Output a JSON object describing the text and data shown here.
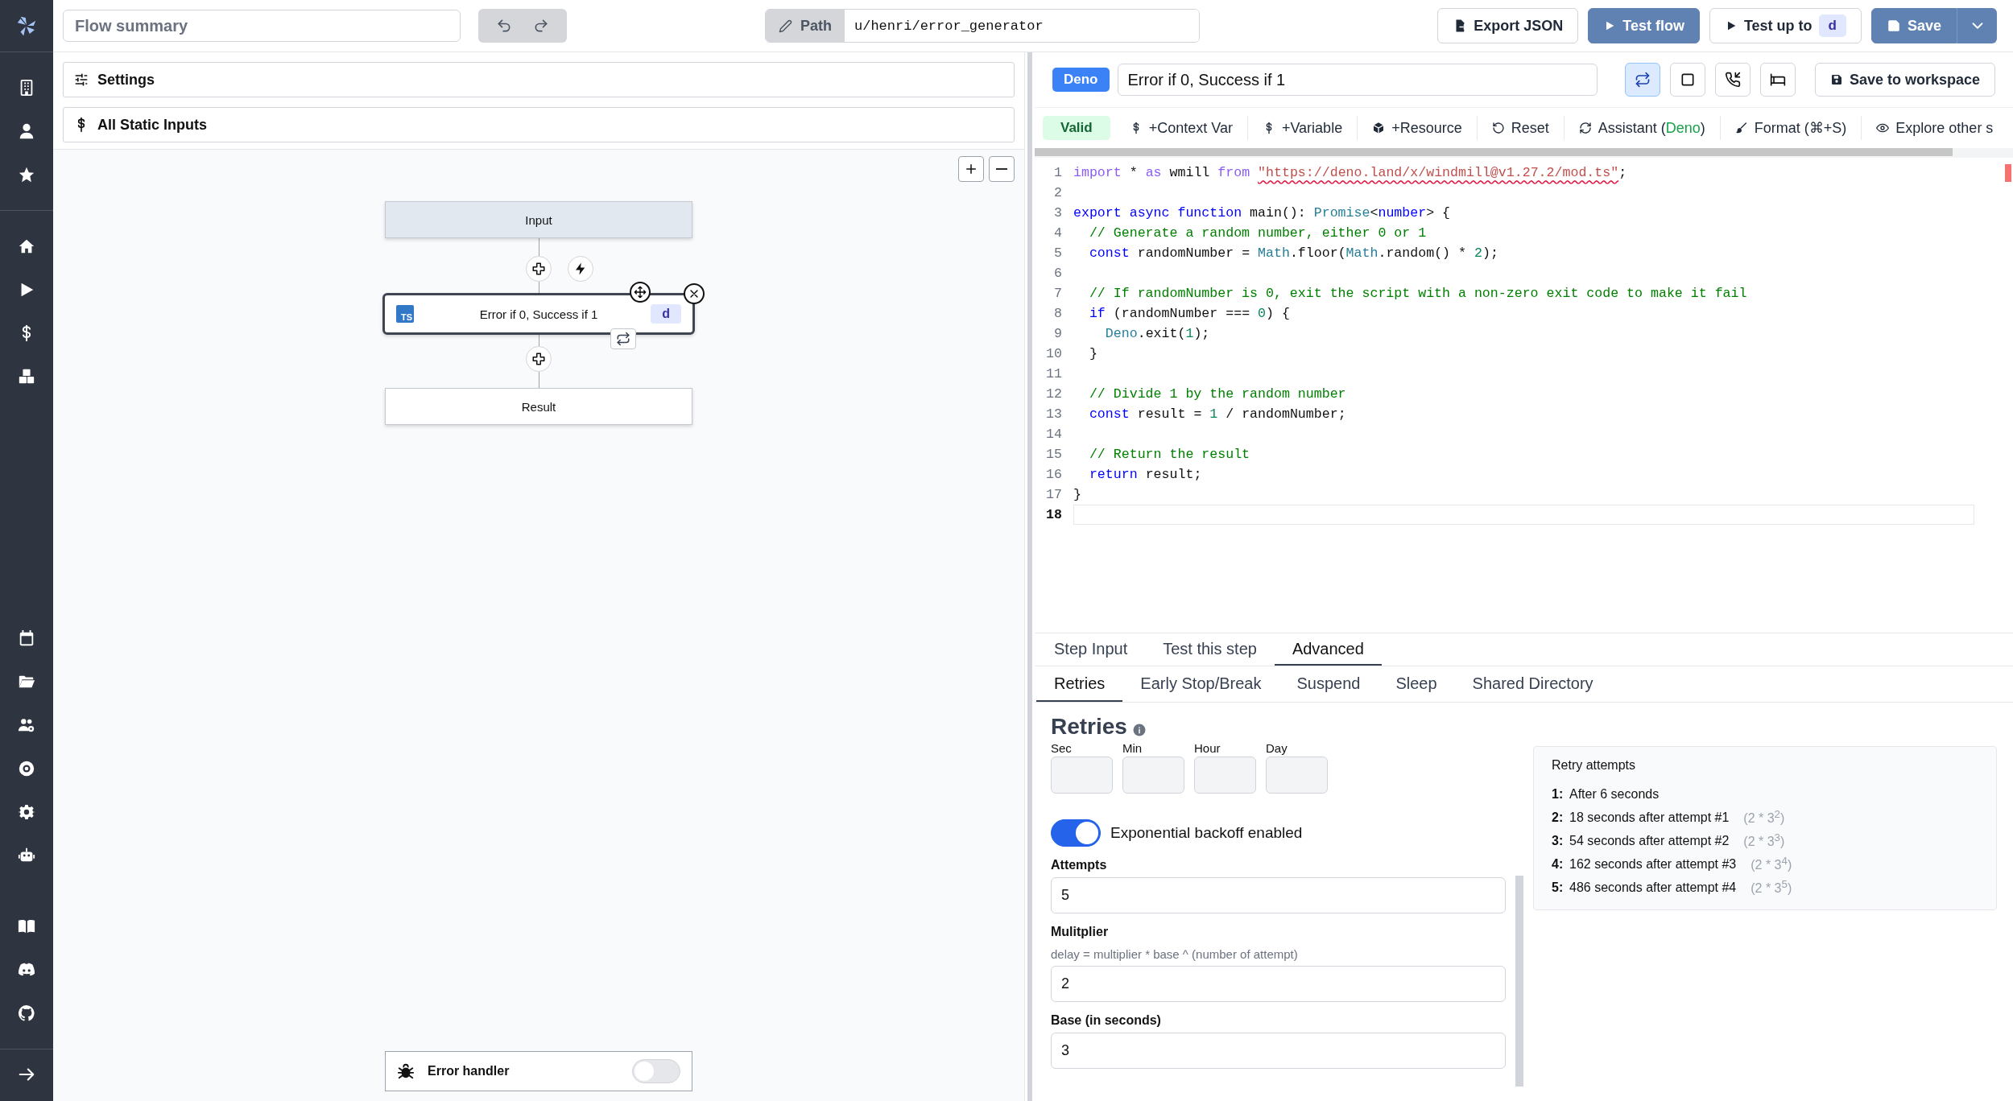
{
  "header": {
    "summary": {
      "placeholder": "Flow summary"
    },
    "path": {
      "label": "Path",
      "value": "u/henri/error_generator"
    },
    "actions": [
      {
        "kind": "export",
        "label": "Export JSON"
      },
      {
        "kind": "test",
        "label": "Test flow"
      },
      {
        "kind": "test_up_to",
        "label": "Test up to",
        "badge": "d"
      },
      {
        "kind": "save",
        "label": "Save"
      }
    ]
  },
  "left_panel": {
    "sections": [
      {
        "kind": "settings",
        "label": "Settings"
      },
      {
        "kind": "static_inputs",
        "label": "All Static Inputs"
      }
    ],
    "flow": {
      "nodes": [
        {
          "kind": "input",
          "label": "Input",
          "selected": false
        },
        {
          "kind": "step",
          "lang_icon": "TS",
          "label": "Error if 0, Success if 1",
          "badge": "d",
          "selected": true
        },
        {
          "kind": "result",
          "label": "Result",
          "selected": false
        }
      ]
    },
    "error_handler": {
      "label": "Error handler",
      "on": false
    }
  },
  "editor": {
    "language": "Deno",
    "title": "Error if 0, Success if 1",
    "icon_buttons": [
      {
        "kind": "loop",
        "selected": true
      },
      {
        "kind": "square",
        "selected": false
      },
      {
        "kind": "phone",
        "selected": false
      },
      {
        "kind": "bed",
        "selected": false
      }
    ],
    "save_button": "Save to workspace",
    "toolbar": [
      {
        "kind": "status",
        "label": "Valid"
      },
      {
        "kind": "dollar",
        "label": "+Context Var"
      },
      {
        "kind": "dollar",
        "label": "+Variable"
      },
      {
        "kind": "cube",
        "label": "+Resource"
      },
      {
        "kind": "reset",
        "label": "Reset"
      },
      {
        "kind": "assistant",
        "prefix": "Assistant (",
        "accent": "Deno",
        "suffix": ")"
      },
      {
        "kind": "brush",
        "label": "Format (⌘+S)"
      },
      {
        "kind": "eye",
        "label": "Explore other s"
      }
    ],
    "code": [
      {
        "number": "1",
        "current": false,
        "tokens": [
          {
            "kind": "control",
            "text": "import"
          },
          {
            "kind": "plain",
            "text": " * "
          },
          {
            "kind": "control",
            "text": "as"
          },
          {
            "kind": "plain",
            "text": " wmill "
          },
          {
            "kind": "control",
            "text": "from "
          },
          {
            "kind": "string_error",
            "text": "\"https://deno.land/x/windmill@v1.27.2/mod.ts\""
          },
          {
            "kind": "plain",
            "text": ";"
          }
        ]
      },
      {
        "number": "2",
        "current": false
      },
      {
        "number": "3",
        "current": false,
        "tokens": [
          {
            "kind": "keyword",
            "text": "export async function"
          },
          {
            "kind": "plain",
            "text": " main(): "
          },
          {
            "kind": "type",
            "text": "Promise"
          },
          {
            "kind": "plain",
            "text": "<"
          },
          {
            "kind": "keyword",
            "text": "number"
          },
          {
            "kind": "plain",
            "text": "> {"
          }
        ]
      },
      {
        "number": "4",
        "current": false,
        "tokens": [
          {
            "kind": "comment",
            "text": "  // Generate a random number, either 0 or 1"
          }
        ]
      },
      {
        "number": "5",
        "current": false,
        "tokens": [
          {
            "kind": "keyword",
            "text": "  const"
          },
          {
            "kind": "plain",
            "text": " randomNumber = "
          },
          {
            "kind": "type",
            "text": "Math"
          },
          {
            "kind": "plain",
            "text": ".floor("
          },
          {
            "kind": "type",
            "text": "Math"
          },
          {
            "kind": "plain",
            "text": ".random() * "
          },
          {
            "kind": "number",
            "text": "2"
          },
          {
            "kind": "plain",
            "text": ");"
          }
        ]
      },
      {
        "number": "6",
        "current": false
      },
      {
        "number": "7",
        "current": false,
        "tokens": [
          {
            "kind": "comment",
            "text": "  // If randomNumber is 0, exit the script with a non-zero exit code to make it fail"
          }
        ]
      },
      {
        "number": "8",
        "current": false,
        "tokens": [
          {
            "kind": "keyword",
            "text": "  if"
          },
          {
            "kind": "plain",
            "text": " (randomNumber === "
          },
          {
            "kind": "number",
            "text": "0"
          },
          {
            "kind": "plain",
            "text": ") {"
          }
        ]
      },
      {
        "number": "9",
        "current": false,
        "tokens": [
          {
            "kind": "type",
            "text": "    Deno"
          },
          {
            "kind": "plain",
            "text": ".exit("
          },
          {
            "kind": "number",
            "text": "1"
          },
          {
            "kind": "plain",
            "text": ");"
          }
        ]
      },
      {
        "number": "10",
        "current": false,
        "tokens": [
          {
            "kind": "plain",
            "text": "  }"
          }
        ]
      },
      {
        "number": "11",
        "current": false
      },
      {
        "number": "12",
        "current": false,
        "tokens": [
          {
            "kind": "comment",
            "text": "  // Divide 1 by the random number"
          }
        ]
      },
      {
        "number": "13",
        "current": false,
        "tokens": [
          {
            "kind": "keyword",
            "text": "  const"
          },
          {
            "kind": "plain",
            "text": " result = "
          },
          {
            "kind": "number",
            "text": "1"
          },
          {
            "kind": "plain",
            "text": " / randomNumber;"
          }
        ]
      },
      {
        "number": "14",
        "current": false
      },
      {
        "number": "15",
        "current": false,
        "tokens": [
          {
            "kind": "comment",
            "text": "  // Return the result"
          }
        ]
      },
      {
        "number": "16",
        "current": false,
        "tokens": [
          {
            "kind": "keyword",
            "text": "  return"
          },
          {
            "kind": "plain",
            "text": " result;"
          }
        ]
      },
      {
        "number": "17",
        "current": false,
        "tokens": [
          {
            "kind": "plain",
            "text": "}"
          }
        ]
      },
      {
        "number": "18",
        "current": true
      }
    ]
  },
  "step_panel": {
    "tabs": [
      {
        "label": "Step Input",
        "selected": false
      },
      {
        "label": "Test this step",
        "selected": false
      },
      {
        "label": "Advanced",
        "selected": true
      }
    ],
    "subtabs": [
      {
        "label": "Retries",
        "selected": true
      },
      {
        "label": "Early Stop/Break",
        "selected": false
      },
      {
        "label": "Suspend",
        "selected": false
      },
      {
        "label": "Sleep",
        "selected": false
      },
      {
        "label": "Shared Directory",
        "selected": false
      }
    ],
    "retries": {
      "title": "Retries",
      "delay_fields": [
        {
          "label": "Sec"
        },
        {
          "label": "Min"
        },
        {
          "label": "Hour"
        },
        {
          "label": "Day"
        }
      ],
      "backoff": {
        "label": "Exponential backoff enabled",
        "on": true
      },
      "fields": [
        {
          "label": "Attempts",
          "value": "5"
        },
        {
          "label": "Mulitplier",
          "hint": "delay = multiplier * base ^ (number of attempt)",
          "value": "2"
        },
        {
          "label": "Base (in seconds)",
          "value": "3"
        }
      ],
      "attempts_box": {
        "title": "Retry attempts",
        "items": [
          {
            "index": "1:",
            "text": "After 6 seconds"
          },
          {
            "index": "2:",
            "text": "18 seconds after attempt #1",
            "formula": "(2 * 3$^{2}$)"
          },
          {
            "index": "3:",
            "text": "54 seconds after attempt #2",
            "formula": "(2 * 3$^{3}$)"
          },
          {
            "index": "4:",
            "text": "162 seconds after attempt #3",
            "formula": "(2 * 3$^{4}$)"
          },
          {
            "index": "5:",
            "text": "486 seconds after attempt #4",
            "formula": "(2 * 3$^{5}$)"
          }
        ]
      }
    }
  }
}
